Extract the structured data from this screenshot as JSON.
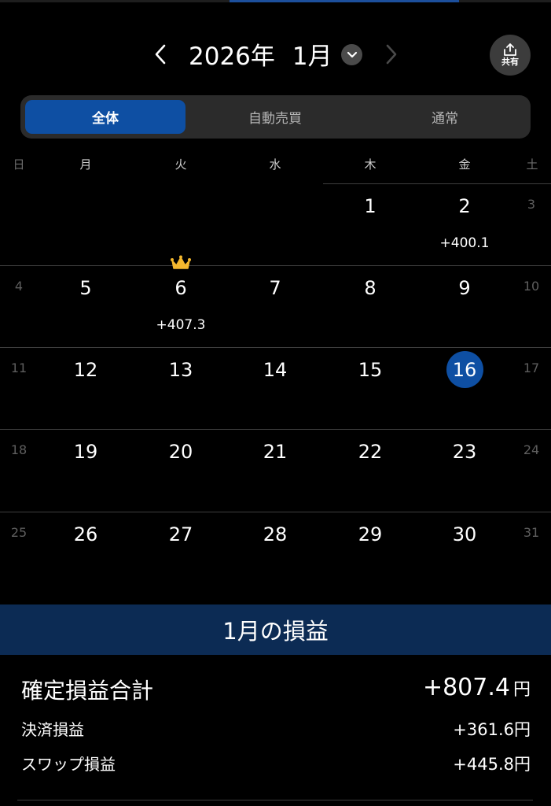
{
  "header": {
    "year_label": "2026年",
    "month_label": "1月",
    "share_label": "共有"
  },
  "tabs": [
    {
      "label": "全体",
      "active": true
    },
    {
      "label": "自動売買",
      "active": false
    },
    {
      "label": "通常",
      "active": false
    }
  ],
  "weekdays": [
    "日",
    "月",
    "火",
    "水",
    "木",
    "金",
    "土"
  ],
  "calendar": {
    "weeks": [
      [
        null,
        null,
        null,
        null,
        "1",
        "2",
        "3"
      ],
      [
        "4",
        "5",
        "6",
        "7",
        "8",
        "9",
        "10"
      ],
      [
        "11",
        "12",
        "13",
        "14",
        "15",
        "16",
        "17"
      ],
      [
        "18",
        "19",
        "20",
        "21",
        "22",
        "23",
        "24"
      ],
      [
        "25",
        "26",
        "27",
        "28",
        "29",
        "30",
        "31"
      ]
    ],
    "today": "16",
    "profits": {
      "jan2": "+400.1",
      "jan6": "+407.3"
    },
    "best_day": "6"
  },
  "summary": {
    "title": "1月の損益",
    "total_label": "確定損益合計",
    "total_value": "+807.4",
    "total_unit": "円",
    "settlement_label": "決済損益",
    "settlement_value": "+361.6円",
    "swap_label": "スワップ損益",
    "swap_value": "+445.8円"
  },
  "colors": {
    "accent": "#0e4fa3",
    "summary_header": "#0c2b54",
    "crown": "#f5b82e"
  }
}
